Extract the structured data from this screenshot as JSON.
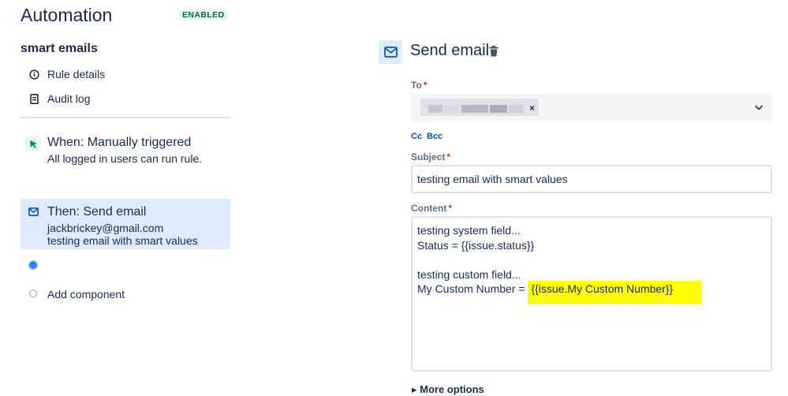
{
  "header": {
    "title": "Automation",
    "status": "ENABLED"
  },
  "rule": {
    "name": "smart emails"
  },
  "nav": {
    "rule_details": "Rule details",
    "audit_log": "Audit log"
  },
  "steps": {
    "trigger": {
      "title": "When: Manually triggered",
      "subtitle": "All logged in users can run rule."
    },
    "action": {
      "title": "Then: Send email",
      "line1": "jackbrickey@gmail.com",
      "line2": "testing email with smart values"
    }
  },
  "add_component": "Add component",
  "panel": {
    "title": "Send email",
    "to_label": "To",
    "cc": "Cc",
    "bcc": "Bcc",
    "subject_label": "Subject",
    "subject_value": "testing email with smart values",
    "content_label": "Content",
    "content": {
      "line1": "testing system field...",
      "line2": "Status = {{issue.status}}",
      "line4": "testing custom field...",
      "line5_prefix": "My Custom Number = ",
      "line5_highlight": "{{issue.My Custom Number}}"
    },
    "required_mark": "*",
    "chip_remove": "×",
    "more_options": "More options"
  },
  "colors": {
    "accent": "#0052cc",
    "selected_step_bg": "#deebff",
    "highlight": "#ffff00",
    "badge_text": "#006644"
  }
}
